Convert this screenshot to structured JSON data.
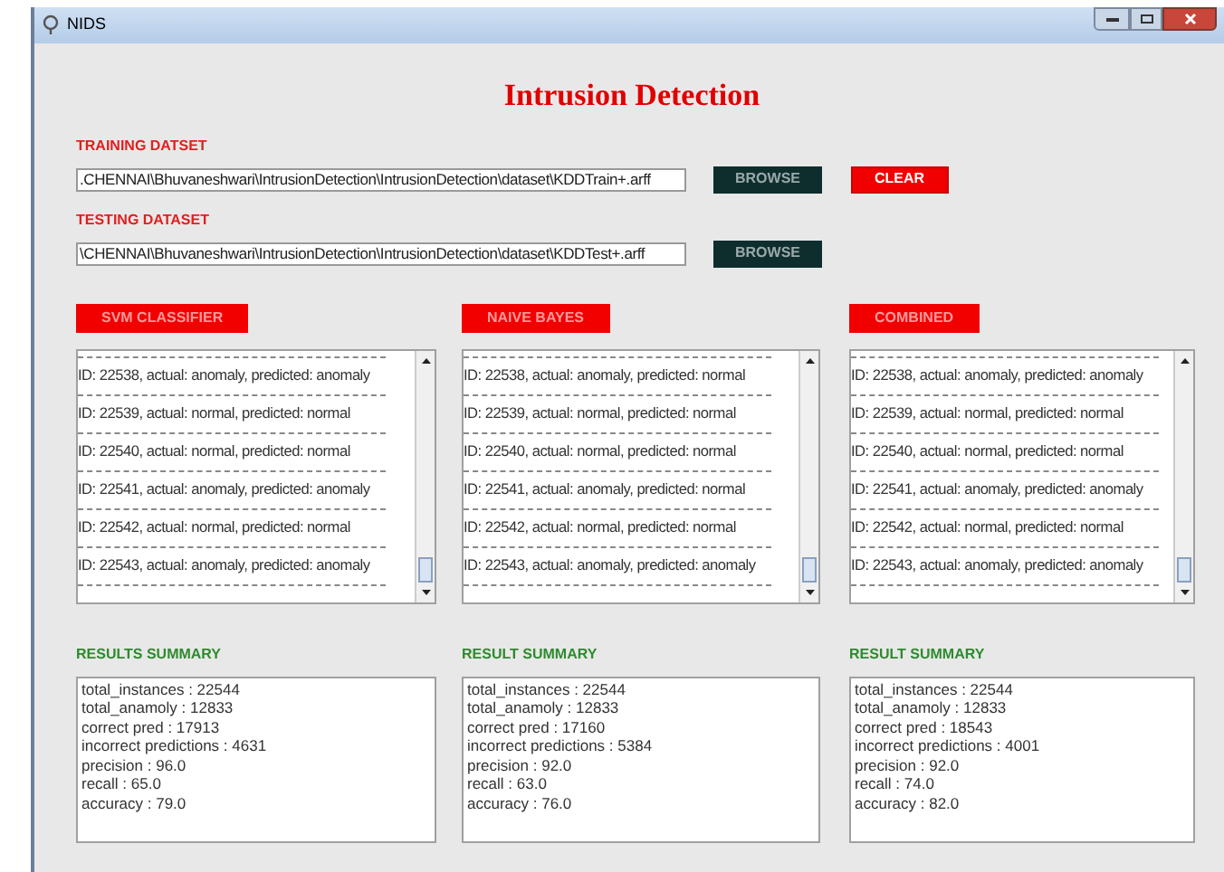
{
  "window": {
    "title": "NIDS"
  },
  "heading": "Intrusion Detection",
  "datasets": [
    {
      "label": "TRAINING DATSET",
      "value": ".CHENNAI\\Bhuvaneshwari\\IntrusionDetection\\IntrusionDetection\\dataset\\KDDTrain+.arff",
      "buttons": [
        {
          "label": "BROWSE",
          "kind": "browse"
        },
        {
          "label": "CLEAR",
          "kind": "clear"
        }
      ]
    },
    {
      "label": "TESTING DATASET",
      "value": "\\CHENNAI\\Bhuvaneshwari\\IntrusionDetection\\IntrusionDetection\\dataset\\KDDTest+.arff",
      "buttons": [
        {
          "label": "BROWSE",
          "kind": "browse"
        }
      ]
    }
  ],
  "classifiers": [
    {
      "button": "SVM CLASSIFIER",
      "rows": [
        "ID: 22538, actual: anomaly, predicted: anomaly",
        "ID: 22539, actual: normal, predicted: normal",
        "ID: 22540, actual: normal, predicted: normal",
        "ID: 22541, actual: anomaly, predicted: anomaly",
        "ID: 22542, actual: normal, predicted: normal",
        "ID: 22543, actual: anomaly, predicted: anomaly"
      ],
      "summary_title": "RESULTS SUMMARY",
      "summary": [
        "total_instances : 22544",
        "total_anamoly : 12833",
        "correct pred : 17913",
        "incorrect predictions : 4631",
        "precision : 96.0",
        "recall : 65.0",
        "accuracy : 79.0"
      ]
    },
    {
      "button": "NAIVE BAYES",
      "rows": [
        "ID: 22538, actual: anomaly, predicted: normal",
        "ID: 22539, actual: normal, predicted: normal",
        "ID: 22540, actual: normal, predicted: normal",
        "ID: 22541, actual: anomaly, predicted: normal",
        "ID: 22542, actual: normal, predicted: normal",
        "ID: 22543, actual: anomaly, predicted: anomaly"
      ],
      "summary_title": "RESULT SUMMARY",
      "summary": [
        "total_instances : 22544",
        "total_anamoly : 12833",
        "correct pred : 17160",
        "incorrect predictions : 5384",
        "precision : 92.0",
        "recall : 63.0",
        "accuracy : 76.0"
      ]
    },
    {
      "button": "COMBINED",
      "rows": [
        "ID: 22538, actual: anomaly, predicted: anomaly",
        "ID: 22539, actual: normal, predicted: normal",
        "ID: 22540, actual: normal, predicted: normal",
        "ID: 22541, actual: anomaly, predicted: anomaly",
        "ID: 22542, actual: normal, predicted: normal",
        "ID: 22543, actual: anomaly, predicted: anomaly"
      ],
      "summary_title": "RESULT SUMMARY",
      "summary": [
        "total_instances : 22544",
        "total_anamoly : 12833",
        "correct pred : 18543",
        "incorrect predictions : 4001",
        "precision : 92.0",
        "recall : 74.0",
        "accuracy : 82.0"
      ]
    }
  ]
}
